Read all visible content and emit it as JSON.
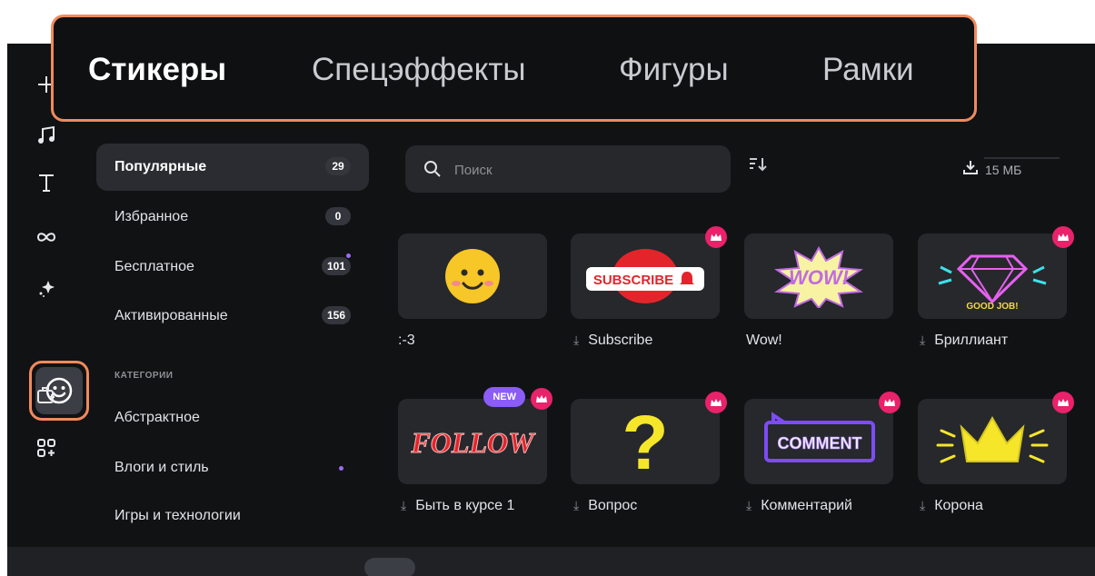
{
  "tabs": [
    {
      "label": "Стикеры",
      "active": true
    },
    {
      "label": "Спецэффекты",
      "active": false
    },
    {
      "label": "Фигуры",
      "active": false
    },
    {
      "label": "Рамки",
      "active": false
    }
  ],
  "rail": {
    "icons": [
      "plus-icon",
      "music-note-icon",
      "text-icon",
      "transition-infinity-icon",
      "sparkle-effects-icon",
      "sticker-smiley-icon",
      "add-media-icon",
      "add-apps-icon"
    ],
    "active": "sticker-smiley-icon"
  },
  "categories": [
    {
      "label": "Популярные",
      "count": "29",
      "active": true
    },
    {
      "label": "Избранное",
      "count": "0"
    },
    {
      "label": "Бесплатное",
      "count": "101",
      "has_dot": true
    },
    {
      "label": "Активированные",
      "count": "156"
    }
  ],
  "categories_heading": "КАТЕГОРИИ",
  "themes": [
    {
      "label": "Абстрактное"
    },
    {
      "label": "Влоги и стиль",
      "has_dot": true
    },
    {
      "label": "Игры и технологии"
    }
  ],
  "search": {
    "placeholder": "Поиск",
    "value": ""
  },
  "download_size": "15 МБ",
  "stickers": [
    {
      "label": ":-3",
      "downloaded": true,
      "premium": false,
      "new": false,
      "art": "smiley"
    },
    {
      "label": "Subscribe",
      "downloaded": false,
      "premium": true,
      "new": false,
      "art": "subscribe",
      "art_text": "SUBSCRIBE"
    },
    {
      "label": "Wow!",
      "downloaded": true,
      "premium": false,
      "new": false,
      "art": "wow",
      "art_text": "WOW!"
    },
    {
      "label": "Бриллиант",
      "downloaded": false,
      "premium": true,
      "new": false,
      "art": "diamond",
      "art_text": "GOOD JOB!"
    },
    {
      "label": "Быть в курсе 1",
      "downloaded": false,
      "premium": true,
      "new": true,
      "new_label": "NEW",
      "art": "follow",
      "art_text": "FOLLOW"
    },
    {
      "label": "Вопрос",
      "downloaded": false,
      "premium": true,
      "new": false,
      "art": "question",
      "art_text": "?"
    },
    {
      "label": "Комментарий",
      "downloaded": false,
      "premium": true,
      "new": false,
      "art": "comment",
      "art_text": "COMMENT"
    },
    {
      "label": "Корона",
      "downloaded": false,
      "premium": true,
      "new": false,
      "art": "crown"
    }
  ],
  "colors": {
    "highlight": "#f08a5d",
    "premium": "#e8226b",
    "new_badge": "#8b5cf6",
    "background": "#111214",
    "panel": "#26282c"
  }
}
